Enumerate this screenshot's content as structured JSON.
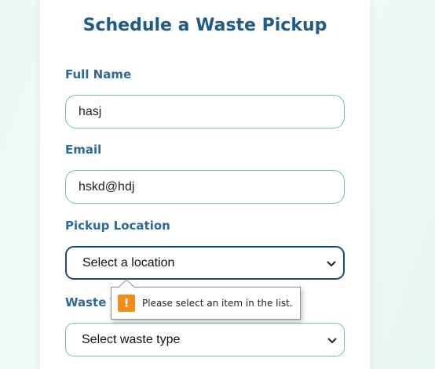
{
  "form": {
    "title": "Schedule a Waste Pickup",
    "full_name_label": "Full Name",
    "full_name_value": "hasj",
    "email_label": "Email",
    "email_value": "hskd@hdj",
    "location_label": "Pickup Location",
    "location_selected": "Select a location",
    "waste_type_label": "Waste T",
    "waste_type_selected": "Select waste type"
  },
  "validation": {
    "message": "Please select an item in the list.",
    "icon": "warning-icon",
    "icon_glyph": "!"
  },
  "colors": {
    "title": "#1e5a8a",
    "label": "#2a6a9a",
    "field_border": "#5cc9aa",
    "focus_border": "#1c4b78",
    "warning": "#f08c1a"
  }
}
